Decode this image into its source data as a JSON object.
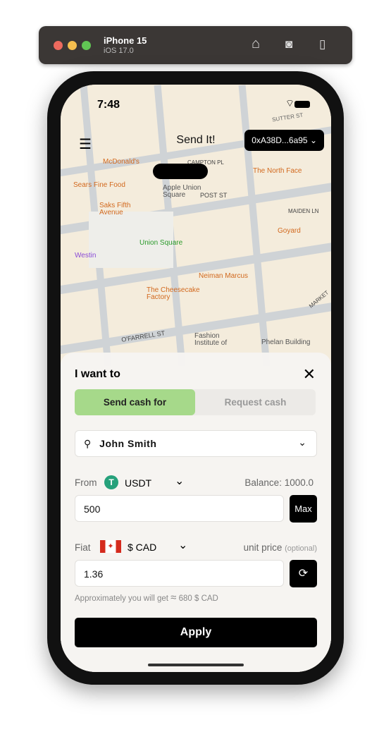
{
  "simulator": {
    "device": "iPhone 15",
    "os": "iOS 17.0",
    "traffic_lights": [
      "#ed6a5e",
      "#f5bf4f",
      "#61c554"
    ],
    "icons": [
      "home-icon",
      "screenshot-icon",
      "rotate-icon"
    ]
  },
  "status_bar": {
    "time": "7:48"
  },
  "header": {
    "title": "Send It!",
    "wallet": "0xA38D...6a95"
  },
  "map": {
    "labels": [
      "McDonald's",
      "CAMPTON PL",
      "The North Face",
      "Sears Fine Food",
      "Apple Union Square",
      "POST ST",
      "Saks Fifth Avenue",
      "MAIDEN LN",
      "Goyard",
      "Union Square",
      "Westin",
      "Neiman Marcus",
      "The Cheesecake Factory",
      "O'FARRELL ST",
      "Fashion Institute of",
      "Phelan Building",
      "MARKET",
      "SUTTER ST"
    ]
  },
  "sheet": {
    "title": "I want to",
    "tabs": [
      {
        "label": "Send cash for",
        "active": true
      },
      {
        "label": "Request cash",
        "active": false
      }
    ],
    "recipient": "John Smith",
    "from_label": "From",
    "token": "USDT",
    "balance": "Balance: 1000.0",
    "amount": "500",
    "max_label": "Max",
    "fiat_label": "Fiat",
    "currency": "$ CAD",
    "unit_price_label": "unit price",
    "optional": "(optional)",
    "unit_price": "1.36",
    "approx_prefix": "Approximately you will get",
    "approx_symbol": "≈",
    "approx_value": "680 $ CAD",
    "apply_label": "Apply",
    "accent": "#a6d98a",
    "token_color": "#26a17b"
  }
}
